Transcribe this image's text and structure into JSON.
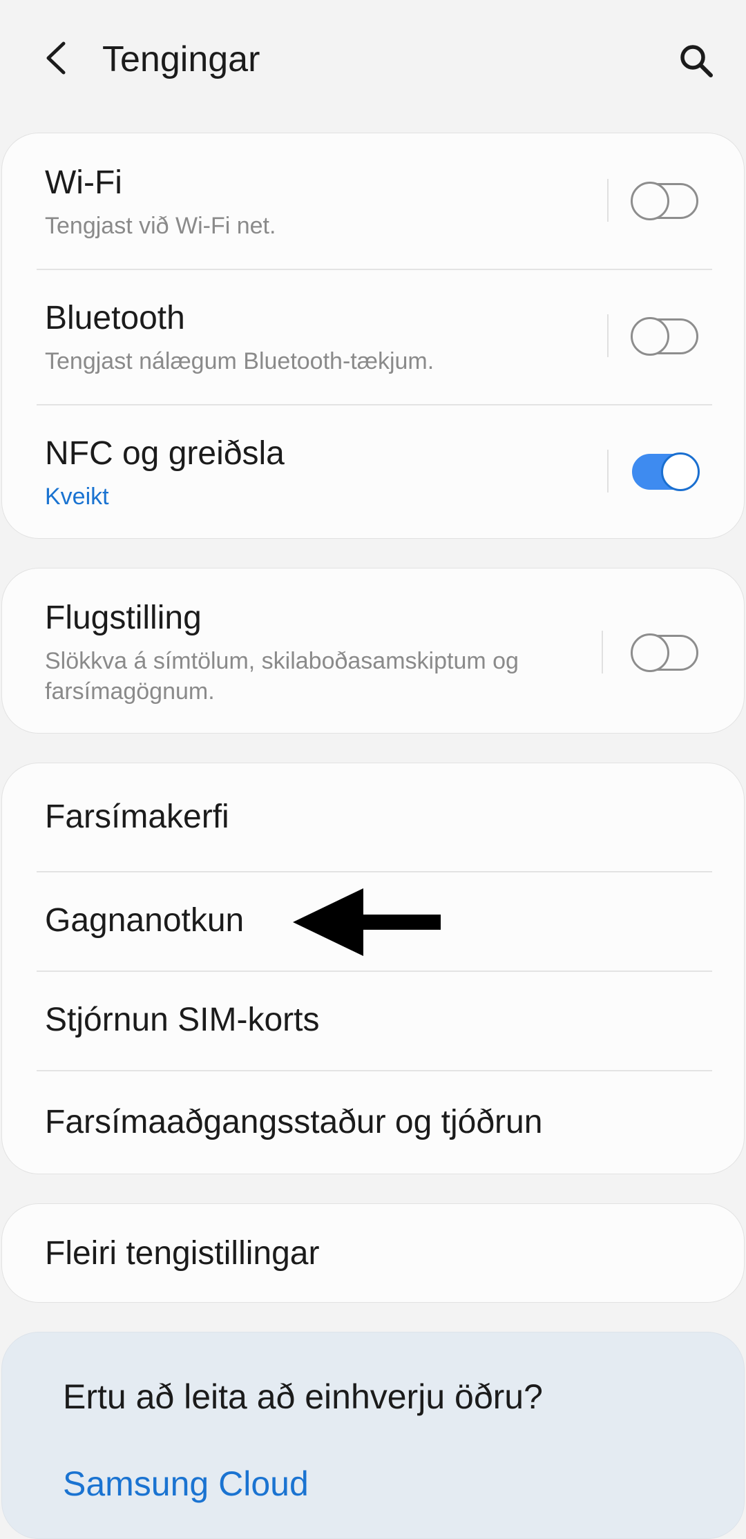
{
  "header": {
    "title": "Tengingar",
    "back_icon": "chevron-left-icon",
    "search_icon": "search-icon"
  },
  "connectivity": {
    "wifi": {
      "title": "Wi-Fi",
      "subtitle": "Tengjast við Wi-Fi net.",
      "enabled": false
    },
    "bluetooth": {
      "title": "Bluetooth",
      "subtitle": "Tengjast nálægum Bluetooth-tækjum.",
      "enabled": false
    },
    "nfc": {
      "title": "NFC og greiðsla",
      "subtitle": "Kveikt",
      "enabled": true
    }
  },
  "airplane": {
    "title": "Flugstilling",
    "subtitle_line1": "Slökkva á símtölum, skilaboðasamskiptum og",
    "subtitle_line2": "farsímagögnum.",
    "enabled": false
  },
  "mobile": {
    "items": [
      {
        "label": "Farsímakerfi"
      },
      {
        "label": "Gagnanotkun"
      },
      {
        "label": "Stjórnun SIM-korts"
      },
      {
        "label": "Farsímaaðgangsstaður og tjóðrun"
      }
    ]
  },
  "more": {
    "label": "Fleiri tengistillingar"
  },
  "suggestions": {
    "question": "Ertu að leita að einhverju öðru?",
    "link": "Samsung Cloud"
  },
  "annotation": {
    "icon": "left-arrow-pointer-icon"
  },
  "colors": {
    "background": "#f3f3f3",
    "card": "#fcfcfc",
    "accent": "#1a73d1",
    "toggle_on": "#3e8bf0",
    "suggest_bg": "#e4ebf2"
  }
}
